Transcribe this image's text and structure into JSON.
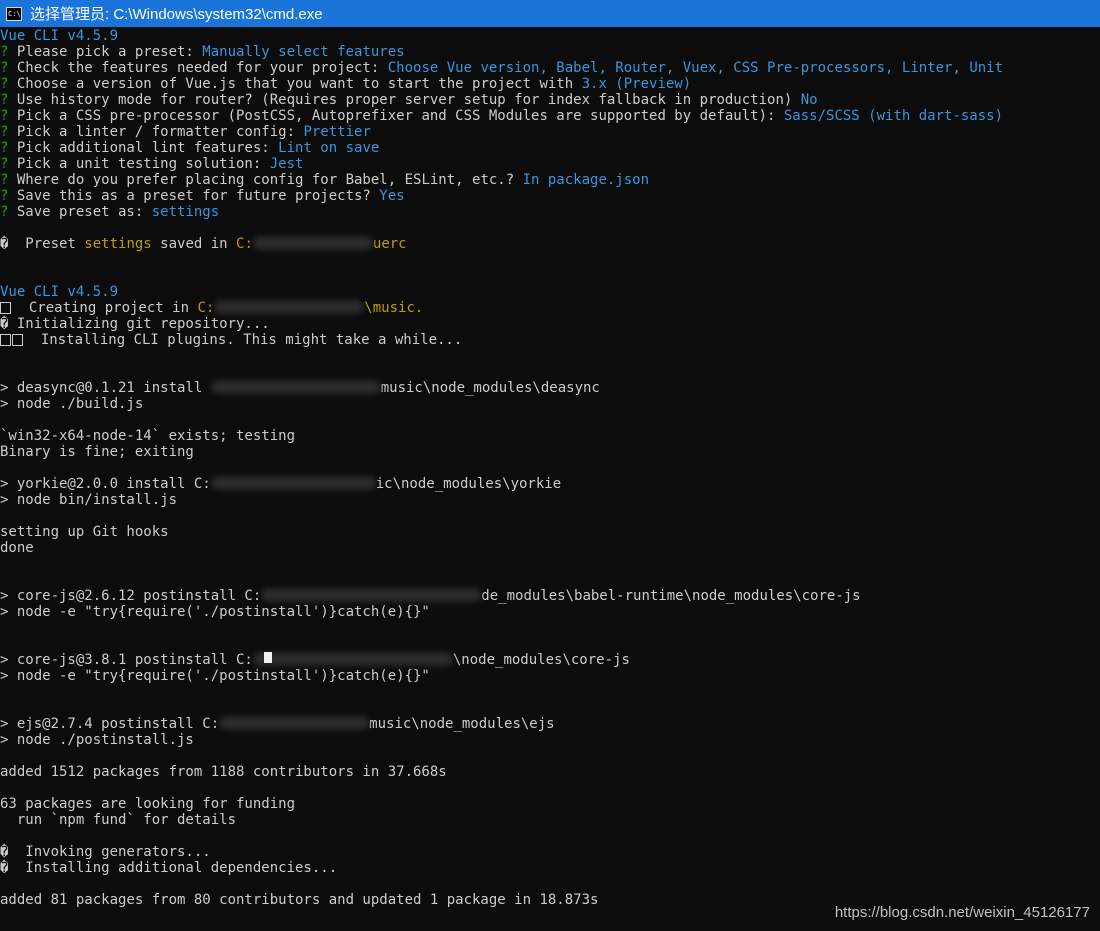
{
  "window": {
    "title": "选择管理员: C:\\Windows\\system32\\cmd.exe",
    "icon": "cmd-icon"
  },
  "lines": [
    {
      "segs": [
        [
          "c",
          "Vue CLI v4.5.9"
        ]
      ]
    },
    {
      "segs": [
        [
          "g",
          "? "
        ],
        [
          "w",
          "Please pick a preset: "
        ],
        [
          "c",
          "Manually select features"
        ]
      ]
    },
    {
      "segs": [
        [
          "g",
          "? "
        ],
        [
          "w",
          "Check the features needed for your project: "
        ],
        [
          "c",
          "Choose Vue version, Babel, Router, Vuex, CSS Pre-processors, Linter, Unit"
        ]
      ]
    },
    {
      "segs": [
        [
          "g",
          "? "
        ],
        [
          "w",
          "Choose a version of Vue.js that you want to start the project with "
        ],
        [
          "c",
          "3.x (Preview)"
        ]
      ]
    },
    {
      "segs": [
        [
          "g",
          "? "
        ],
        [
          "w",
          "Use history mode for router? (Requires proper server setup for index fallback in production) "
        ],
        [
          "c",
          "No"
        ]
      ]
    },
    {
      "segs": [
        [
          "g",
          "? "
        ],
        [
          "w",
          "Pick a CSS pre-processor (PostCSS, Autoprefixer and CSS Modules are supported by default): "
        ],
        [
          "c",
          "Sass/SCSS (with dart-sass)"
        ]
      ]
    },
    {
      "segs": [
        [
          "g",
          "? "
        ],
        [
          "w",
          "Pick a linter / formatter config: "
        ],
        [
          "c",
          "Prettier"
        ]
      ]
    },
    {
      "segs": [
        [
          "g",
          "? "
        ],
        [
          "w",
          "Pick additional lint features: "
        ],
        [
          "c",
          "Lint on save"
        ]
      ]
    },
    {
      "segs": [
        [
          "g",
          "? "
        ],
        [
          "w",
          "Pick a unit testing solution: "
        ],
        [
          "c",
          "Jest"
        ]
      ]
    },
    {
      "segs": [
        [
          "g",
          "? "
        ],
        [
          "w",
          "Where do you prefer placing config for Babel, ESLint, etc.? "
        ],
        [
          "c",
          "In package.json"
        ]
      ]
    },
    {
      "segs": [
        [
          "g",
          "? "
        ],
        [
          "w",
          "Save this as a preset for future projects? "
        ],
        [
          "c",
          "Yes"
        ]
      ]
    },
    {
      "segs": [
        [
          "g",
          "? "
        ],
        [
          "w",
          "Save preset as: "
        ],
        [
          "c",
          "settings"
        ]
      ]
    },
    {
      "segs": []
    },
    {
      "segs": [
        [
          "w",
          "�  Preset "
        ],
        [
          "y",
          "settings"
        ],
        [
          "w",
          " saved in "
        ],
        [
          "y",
          "C:"
        ],
        [
          "blur",
          "120"
        ],
        [
          "y",
          "uerc"
        ]
      ]
    },
    {
      "segs": []
    },
    {
      "segs": []
    },
    {
      "segs": [
        [
          "c",
          "Vue CLI v4.5.9"
        ]
      ]
    },
    {
      "segs": [
        [
          "box",
          "1"
        ],
        [
          "w",
          "  Creating project in "
        ],
        [
          "y",
          "C:"
        ],
        [
          "blur",
          "150"
        ],
        [
          "y",
          "\\music."
        ]
      ]
    },
    {
      "segs": [
        [
          "w",
          "� Initializing git repository..."
        ]
      ]
    },
    {
      "segs": [
        [
          "box",
          "2"
        ],
        [
          "w",
          "  Installing CLI plugins. This might take a while..."
        ]
      ]
    },
    {
      "segs": []
    },
    {
      "segs": []
    },
    {
      "segs": [
        [
          "w",
          "> deasync@0.1.21 install "
        ],
        [
          "blur",
          "170"
        ],
        [
          "w",
          "music\\node_modules\\deasync"
        ]
      ]
    },
    {
      "segs": [
        [
          "w",
          "> node ./build.js"
        ]
      ]
    },
    {
      "segs": []
    },
    {
      "segs": [
        [
          "w",
          "`win32-x64-node-14` exists; testing"
        ]
      ]
    },
    {
      "segs": [
        [
          "w",
          "Binary is fine; exiting"
        ]
      ]
    },
    {
      "segs": []
    },
    {
      "segs": [
        [
          "w",
          "> yorkie@2.0.0 install C:"
        ],
        [
          "blur",
          "165"
        ],
        [
          "w",
          "ic\\node_modules\\yorkie"
        ]
      ]
    },
    {
      "segs": [
        [
          "w",
          "> node bin/install.js"
        ]
      ]
    },
    {
      "segs": []
    },
    {
      "segs": [
        [
          "w",
          "setting up Git hooks"
        ]
      ]
    },
    {
      "segs": [
        [
          "w",
          "done"
        ]
      ]
    },
    {
      "segs": []
    },
    {
      "segs": []
    },
    {
      "segs": [
        [
          "w",
          "> core-js@2.6.12 postinstall C:"
        ],
        [
          "blur",
          "220"
        ],
        [
          "w",
          "de_modules\\babel-runtime\\node_modules\\core-js"
        ]
      ]
    },
    {
      "segs": [
        [
          "w",
          "> node -e \"try{require('./postinstall')}catch(e){}\""
        ]
      ]
    },
    {
      "segs": []
    },
    {
      "segs": []
    },
    {
      "segs": [
        [
          "w",
          "> core-js@3.8.1 postinstall C:"
        ],
        [
          "blur",
          "200"
        ],
        [
          "w",
          "\\node_modules\\core-js"
        ]
      ]
    },
    {
      "segs": [
        [
          "w",
          "> node -e \"try{require('./postinstall')}catch(e){}\""
        ]
      ]
    },
    {
      "segs": []
    },
    {
      "segs": []
    },
    {
      "segs": [
        [
          "w",
          "> ejs@2.7.4 postinstall C:"
        ],
        [
          "blur",
          "150"
        ],
        [
          "w",
          "music\\node_modules\\ejs"
        ]
      ]
    },
    {
      "segs": [
        [
          "w",
          "> node ./postinstall.js"
        ]
      ]
    },
    {
      "segs": []
    },
    {
      "segs": [
        [
          "w",
          "added 1512 packages from 1188 contributors in 37.668s"
        ]
      ]
    },
    {
      "segs": []
    },
    {
      "segs": [
        [
          "w",
          "63 packages are looking for funding"
        ]
      ]
    },
    {
      "segs": [
        [
          "w",
          "  run `npm fund` for details"
        ]
      ]
    },
    {
      "segs": []
    },
    {
      "segs": [
        [
          "w",
          "�  Invoking generators..."
        ]
      ]
    },
    {
      "segs": [
        [
          "w",
          "�  Installing additional dependencies..."
        ]
      ]
    },
    {
      "segs": []
    },
    {
      "segs": [
        [
          "w",
          "added 81 packages from 80 contributors and updated 1 package in 18.873s"
        ]
      ]
    }
  ],
  "watermark": "https://blog.csdn.net/weixin_45126177"
}
